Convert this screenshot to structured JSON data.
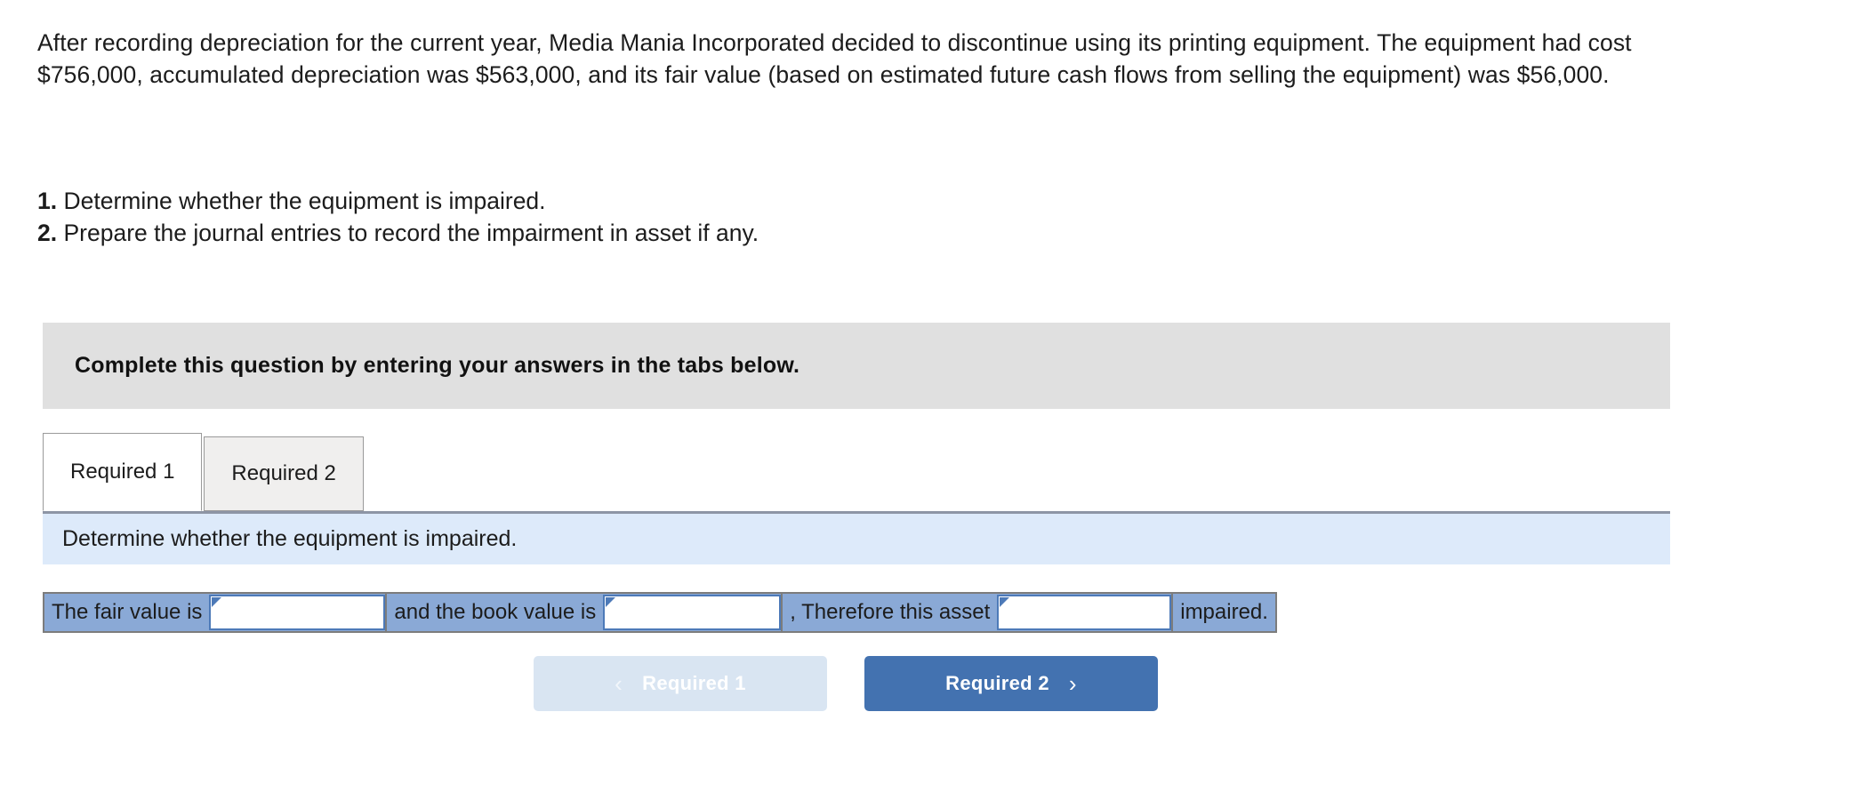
{
  "problem": {
    "statement": "After recording depreciation for the current year, Media Mania Incorporated decided to discontinue using its printing equipment. The equipment had cost $756,000, accumulated depreciation was $563,000, and its fair value (based on estimated future cash flows from selling the equipment) was $56,000.",
    "requirements": [
      {
        "number": "1.",
        "text": "Determine whether the equipment is impaired."
      },
      {
        "number": "2.",
        "text": "Prepare the journal entries to record the impairment in asset if any."
      }
    ]
  },
  "instruction_banner": {
    "text": "Complete this question by entering your answers in the tabs below."
  },
  "tabs": [
    {
      "label": "Required 1",
      "state": "active"
    },
    {
      "label": "Required 2",
      "state": "inactive"
    }
  ],
  "sub_instruction": {
    "text": "Determine whether the equipment is impaired."
  },
  "answer_row": {
    "segments": [
      {
        "type": "text",
        "value": "The fair value is"
      },
      {
        "type": "dropdown",
        "value": "",
        "marker": "corner-marker"
      },
      {
        "type": "text",
        "value": "and the book value is"
      },
      {
        "type": "dropdown",
        "value": "",
        "marker": "corner-marker"
      },
      {
        "type": "text",
        "value": ", Therefore this asset"
      },
      {
        "type": "dropdown",
        "value": "",
        "marker": "corner-marker"
      },
      {
        "type": "text",
        "value": "impaired."
      }
    ]
  },
  "nav_buttons": {
    "prev": {
      "label": "Required 1",
      "icon": "chevron-left-icon",
      "glyph": "‹",
      "state": "disabled"
    },
    "next": {
      "label": "Required 2",
      "icon": "chevron-right-icon",
      "glyph": "›",
      "state": "enabled"
    }
  },
  "colors": {
    "banner_gray": "#e0e0e0",
    "panel_blue": "#ddeafa",
    "cell_blue": "#8aa9d6",
    "button_blue": "#4372b0",
    "button_disabled": "#d9e5f2",
    "dropdown_border": "#4d7ab8"
  }
}
